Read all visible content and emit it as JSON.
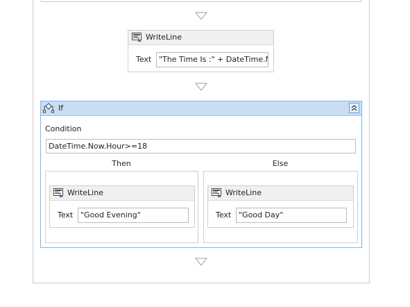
{
  "writeline_main": {
    "title": "WriteLine",
    "text_label": "Text",
    "text_value": "\"The Time Is :\" + DateTime.Now"
  },
  "if_activity": {
    "title": "If",
    "condition_label": "Condition",
    "condition_value": "DateTime.Now.Hour>=18",
    "then_label": "Then",
    "else_label": "Else",
    "then_activity": {
      "title": "WriteLine",
      "text_label": "Text",
      "text_value": "\"Good Evening\""
    },
    "else_activity": {
      "title": "WriteLine",
      "text_label": "Text",
      "text_value": "\"Good Day\""
    }
  },
  "colors": {
    "if_header": "#c9def5",
    "if_border": "#7eb4ea",
    "activity_header": "#f0f0f0"
  },
  "icons": {
    "writeline": "writeline-icon",
    "if": "if-icon",
    "collapse": "collapse-icon",
    "drop_arrow": "drop-arrow-icon"
  }
}
